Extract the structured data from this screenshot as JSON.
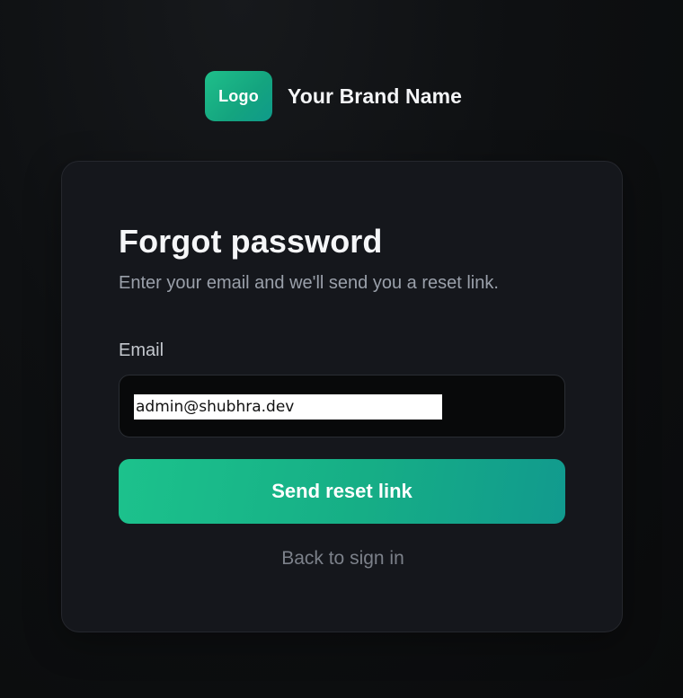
{
  "brand": {
    "logo_text": "Logo",
    "name": "Your Brand Name"
  },
  "form": {
    "title": "Forgot password",
    "subtitle": "Enter your email and we'll send you a reset link.",
    "email_label": "Email",
    "email_value": "admin@shubhra.dev",
    "submit_label": "Send reset link",
    "back_link": "Back to sign in"
  },
  "colors": {
    "background": "#0c0d0f",
    "card": "#15171c",
    "accent_start": "#1cc28c",
    "accent_end": "#119a8e"
  }
}
